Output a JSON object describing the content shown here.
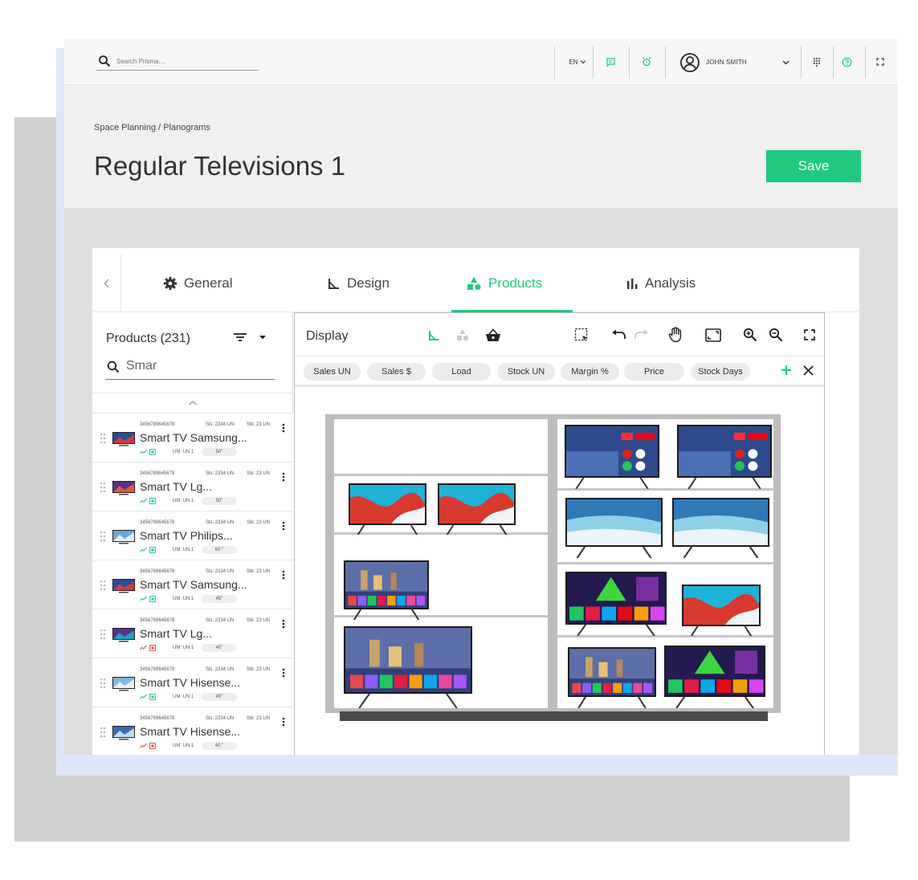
{
  "topbar": {
    "search_placeholder": "Search Prisma....",
    "language": "EN",
    "user_name": "JOHN SMITH",
    "icons": [
      "search-icon",
      "chevron-down-icon",
      "chat-icon",
      "alarm-icon",
      "user-icon",
      "apps-grid-icon",
      "help-icon",
      "fullscreen-icon"
    ]
  },
  "header": {
    "breadcrumb": "Space Planning / Planograms",
    "title": "Regular Televisions 1",
    "save_label": "Save"
  },
  "tabs": [
    {
      "label": "General",
      "icon": "gear-icon"
    },
    {
      "label": "Design",
      "icon": "ruler-icon"
    },
    {
      "label": "Products",
      "icon": "shapes-icon",
      "active": true
    },
    {
      "label": "Analysis",
      "icon": "bar-chart-icon"
    }
  ],
  "colors": {
    "accent": "#21c97f",
    "warning": "#e5484d"
  },
  "products": {
    "title": "Products (231)",
    "filter_value": "Smar",
    "items": [
      {
        "code": "3456789645678",
        "sls": "Sls: 2334 UN",
        "stk": "Stk: 23 UN",
        "name": "Smart TV Samsung...",
        "um": "UM: UN 1",
        "size": "50\"",
        "flag": "ok"
      },
      {
        "code": "3456789645678",
        "sls": "Sls: 2334 UN",
        "stk": "Stk: 23 UN",
        "name": "Smart TV Lg...",
        "um": "UM: UN 1",
        "size": "50\"",
        "flag": "ok"
      },
      {
        "code": "3456789645678",
        "sls": "Sls: 2334 UN",
        "stk": "Stk: 23 UN",
        "name": "Smart TV Philips...",
        "um": "UM: UN 1",
        "size": "60 \"",
        "flag": "ok"
      },
      {
        "code": "3456789645678",
        "sls": "Sls: 2334 UN",
        "stk": "Stk: 23 UN",
        "name": "Smart TV Samsung...",
        "um": "UM: UN 1",
        "size": "45\"",
        "flag": "ok"
      },
      {
        "code": "3456789645678",
        "sls": "Sls: 2334 UN",
        "stk": "Stk: 23 UN",
        "name": "Smart TV Lg...",
        "um": "UM: UN 1",
        "size": "40\"",
        "flag": "warn"
      },
      {
        "code": "3456789645678",
        "sls": "Sls: 2334 UN",
        "stk": "Stk: 23 UN",
        "name": "Smart TV Hisense...",
        "um": "UM: UN 1",
        "size": "45\"",
        "flag": "ok"
      },
      {
        "code": "3456789645678",
        "sls": "Sls: 2334 UN",
        "stk": "Stk: 23 UN",
        "name": "Smart TV Hisense...",
        "um": "UM: UN 1",
        "size": "40 \"",
        "flag": "warn"
      }
    ]
  },
  "display": {
    "title": "Display",
    "chips": [
      "Sales UN",
      "Sales $",
      "Load",
      "Stock UN",
      "Margin %",
      "Price",
      "Stock Days"
    ]
  }
}
